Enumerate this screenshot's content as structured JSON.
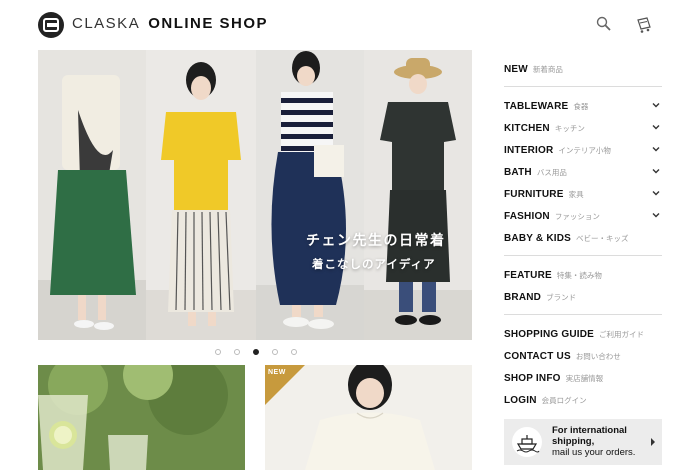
{
  "header": {
    "brand_left": "CLASKA",
    "brand_right": "ONLINE SHOP",
    "icons": [
      "search-icon",
      "cart-icon"
    ]
  },
  "hero": {
    "caption_line1": "チェン先生の日常着",
    "caption_line2": "着こなしのアイディア",
    "slide_count": 5,
    "active_slide": 3
  },
  "cards": {
    "right_badge": "NEW"
  },
  "sidebar": {
    "new": {
      "en": "NEW",
      "ja": "新着商品"
    },
    "categories": [
      {
        "en": "TABLEWARE",
        "ja": "食器",
        "expandable": true
      },
      {
        "en": "KITCHEN",
        "ja": "キッチン",
        "expandable": true
      },
      {
        "en": "INTERIOR",
        "ja": "インテリア小物",
        "expandable": true
      },
      {
        "en": "BATH",
        "ja": "バス用品",
        "expandable": true
      },
      {
        "en": "FURNITURE",
        "ja": "家具",
        "expandable": true
      },
      {
        "en": "FASHION",
        "ja": "ファッション",
        "expandable": true
      },
      {
        "en": "BABY & KIDS",
        "ja": "ベビー・キッズ",
        "expandable": false
      }
    ],
    "features": [
      {
        "en": "FEATURE",
        "ja": "特集・読み物"
      },
      {
        "en": "BRAND",
        "ja": "ブランド"
      }
    ],
    "info": [
      {
        "en": "SHOPPING GUIDE",
        "ja": "ご利用ガイド"
      },
      {
        "en": "CONTACT US",
        "ja": "お問い合わせ"
      },
      {
        "en": "SHOP INFO",
        "ja": "実店舗情報"
      },
      {
        "en": "LOGIN",
        "ja": "会員ログイン"
      }
    ],
    "international": {
      "line1": "For international",
      "line2": "shipping,",
      "line3": "mail us your orders."
    }
  },
  "colors": {
    "text": "#222222",
    "muted": "#999999",
    "separator": "#dcdcdc",
    "new_badge": "#c79a3d",
    "intl_bg": "#ececec"
  }
}
